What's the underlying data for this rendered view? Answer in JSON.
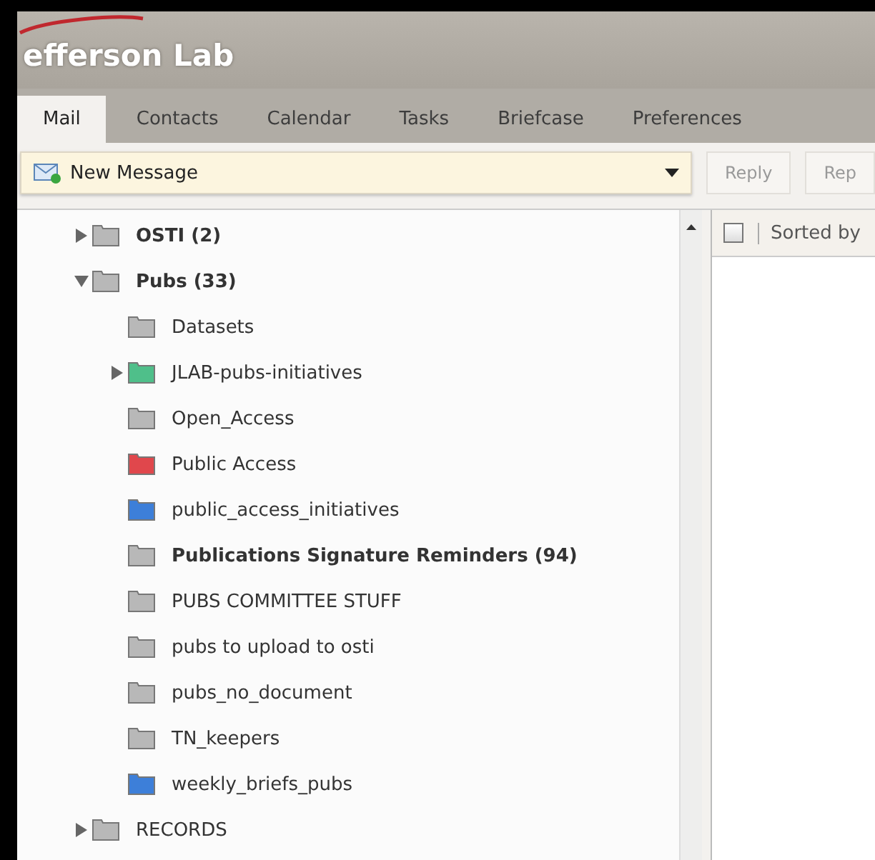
{
  "header": {
    "logo_text": "efferson Lab"
  },
  "tabs": [
    {
      "label": "Mail",
      "selected": true
    },
    {
      "label": "Contacts",
      "selected": false
    },
    {
      "label": "Calendar",
      "selected": false
    },
    {
      "label": "Tasks",
      "selected": false
    },
    {
      "label": "Briefcase",
      "selected": false
    },
    {
      "label": "Preferences",
      "selected": false
    }
  ],
  "toolbar": {
    "new_message": "New Message",
    "buttons": [
      "Reply",
      "Rep"
    ]
  },
  "folders": [
    {
      "label": "OSTI (2)",
      "unread": true,
      "expanded": false,
      "color": "#b8b8b8"
    },
    {
      "label": "Pubs (33)",
      "unread": true,
      "expanded": true,
      "color": "#b8b8b8",
      "children": [
        {
          "label": "Datasets",
          "unread": false,
          "color": "#b8b8b8"
        },
        {
          "label": "JLAB-pubs-initiatives",
          "unread": false,
          "expanded": false,
          "color": "#4fbf8a"
        },
        {
          "label": "Open_Access",
          "unread": false,
          "color": "#b8b8b8"
        },
        {
          "label": "Public Access",
          "unread": false,
          "color": "#e0474c"
        },
        {
          "label": "public_access_initiatives",
          "unread": false,
          "color": "#3d7fd9"
        },
        {
          "label": "Publications Signature Reminders (94)",
          "unread": true,
          "color": "#b8b8b8"
        },
        {
          "label": "PUBS COMMITTEE STUFF",
          "unread": false,
          "color": "#b8b8b8"
        },
        {
          "label": "pubs to upload to osti",
          "unread": false,
          "color": "#b8b8b8"
        },
        {
          "label": "pubs_no_document",
          "unread": false,
          "color": "#b8b8b8"
        },
        {
          "label": "TN_keepers",
          "unread": false,
          "color": "#b8b8b8"
        },
        {
          "label": "weekly_briefs_pubs",
          "unread": false,
          "color": "#3d7fd9"
        }
      ]
    },
    {
      "label": "RECORDS",
      "unread": false,
      "expanded": false,
      "color": "#b8b8b8"
    }
  ],
  "message_list": {
    "select_all_checked": false,
    "sort_label": "Sorted by"
  }
}
